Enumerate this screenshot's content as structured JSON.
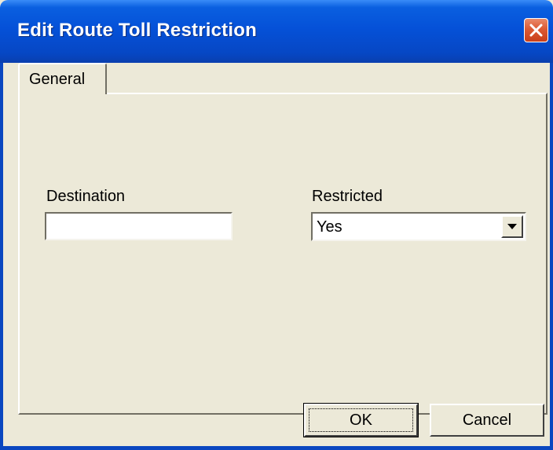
{
  "window": {
    "title": "Edit Route Toll Restriction"
  },
  "tabs": [
    {
      "label": "General",
      "selected": true
    }
  ],
  "form": {
    "destination": {
      "label": "Destination",
      "value": ""
    },
    "restricted": {
      "label": "Restricted",
      "value": "Yes"
    }
  },
  "buttons": {
    "ok_label": "OK",
    "cancel_label": "Cancel"
  },
  "icons": {
    "close": "close-icon",
    "dropdown": "chevron-down-icon"
  },
  "colors": {
    "titlebar": "#0551d8",
    "close_button": "#dc5a34",
    "dialog_background": "#ece9d8"
  }
}
